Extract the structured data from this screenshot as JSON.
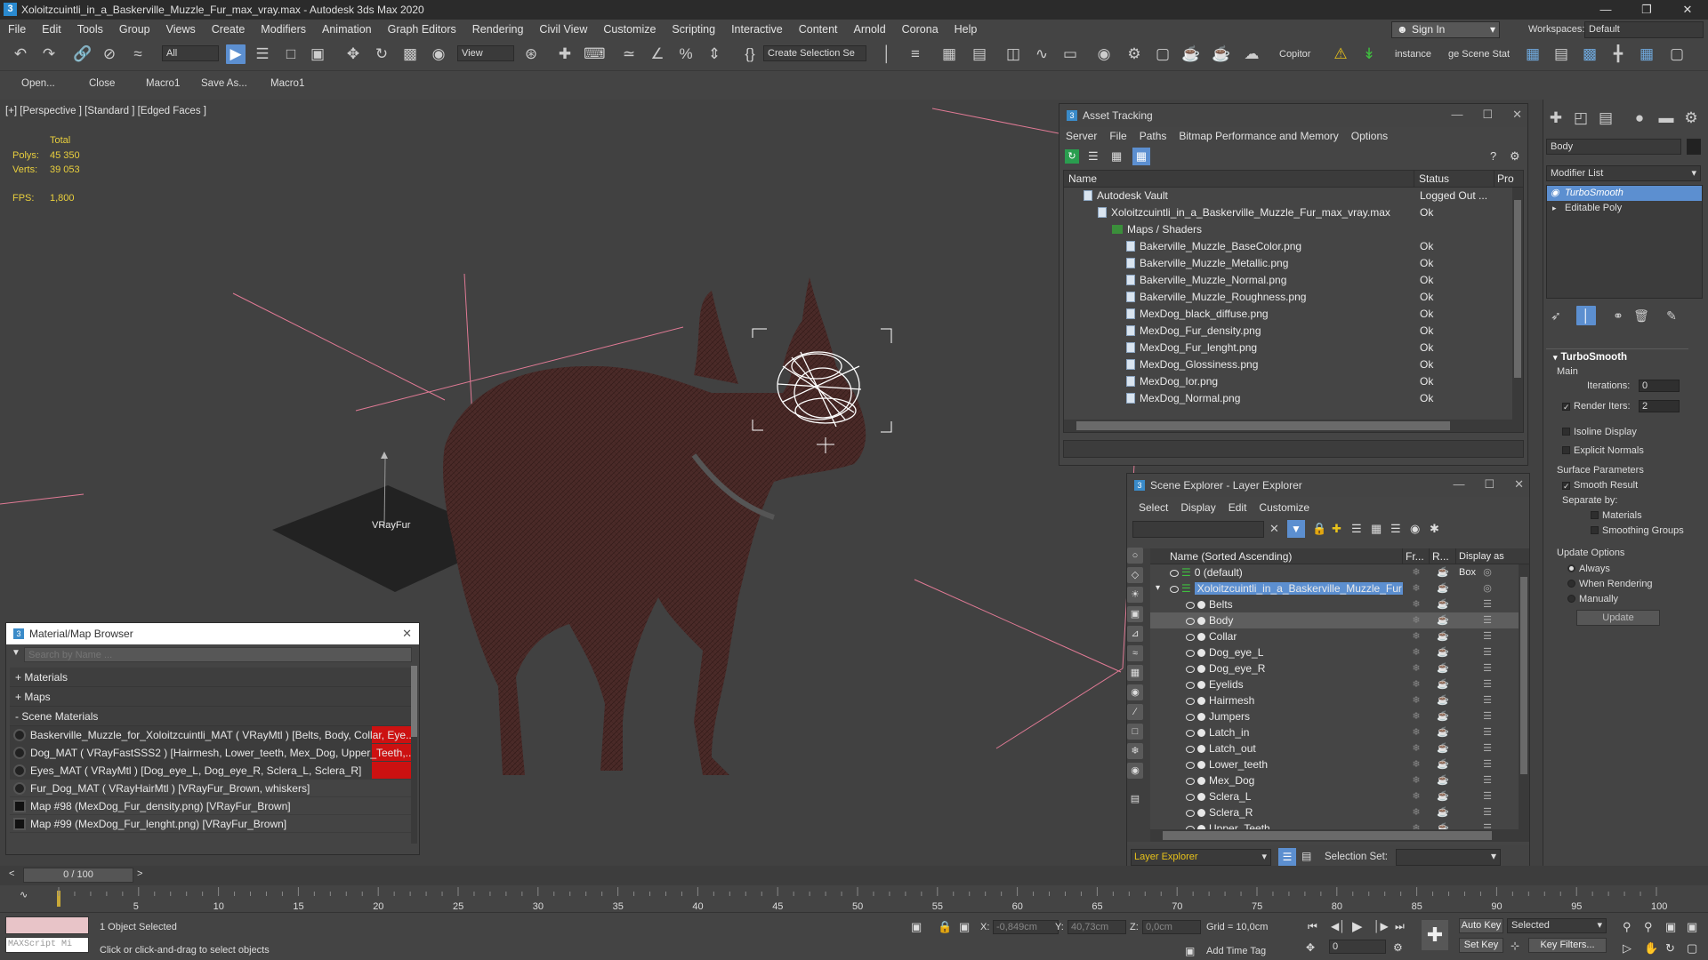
{
  "title": "Xoloitzcuintli_in_a_Baskerville_Muzzle_Fur_max_vray.max - Autodesk 3ds Max 2020",
  "menu": [
    "File",
    "Edit",
    "Tools",
    "Group",
    "Views",
    "Create",
    "Modifiers",
    "Animation",
    "Graph Editors",
    "Rendering",
    "Civil View",
    "Customize",
    "Scripting",
    "Interactive",
    "Content",
    "Arnold",
    "Corona",
    "Help"
  ],
  "signin": "Sign In",
  "workspaces_label": "Workspaces:",
  "workspace": "Default",
  "toolbar": {
    "filter": "All",
    "view": "View",
    "selection_set": "Create Selection Se",
    "copitor": "Copitor",
    "instance": "instance",
    "scene_stat": "ge Scene Stat"
  },
  "macros": [
    "Open...",
    "Close",
    "Macro1",
    "Save As...",
    "Macro1"
  ],
  "viewport": {
    "label": "[+] [Perspective ] [Standard ] [Edged Faces ]",
    "total_label": "Total",
    "polys_label": "Polys:",
    "polys_value": "45 350",
    "verts_label": "Verts:",
    "verts_value": "39 053",
    "fps_label": "FPS:",
    "fps_value": "1,800",
    "vrayfur_label": "VRayFur"
  },
  "asset_tracking": {
    "title": "Asset Tracking",
    "menu": [
      "Server",
      "File",
      "Paths",
      "Bitmap Performance and Memory",
      "Options"
    ],
    "headers": [
      "Name",
      "Status",
      "Pro"
    ],
    "rows": [
      {
        "name": "Autodesk Vault",
        "status": "Logged Out ..."
      },
      {
        "name": "Xoloitzcuintli_in_a_Baskerville_Muzzle_Fur_max_vray.max",
        "status": "Ok"
      },
      {
        "name": "Maps / Shaders",
        "status": ""
      },
      {
        "name": "Bakerville_Muzzle_BaseColor.png",
        "status": "Ok"
      },
      {
        "name": "Bakerville_Muzzle_Metallic.png",
        "status": "Ok"
      },
      {
        "name": "Bakerville_Muzzle_Normal.png",
        "status": "Ok"
      },
      {
        "name": "Bakerville_Muzzle_Roughness.png",
        "status": "Ok"
      },
      {
        "name": "MexDog_black_diffuse.png",
        "status": "Ok"
      },
      {
        "name": "MexDog_Fur_density.png",
        "status": "Ok"
      },
      {
        "name": "MexDog_Fur_lenght.png",
        "status": "Ok"
      },
      {
        "name": "MexDog_Glossiness.png",
        "status": "Ok"
      },
      {
        "name": "MexDog_Ior.png",
        "status": "Ok"
      },
      {
        "name": "MexDog_Normal.png",
        "status": "Ok"
      }
    ]
  },
  "scene_explorer": {
    "title": "Scene Explorer - Layer Explorer",
    "menu": [
      "Select",
      "Display",
      "Edit",
      "Customize"
    ],
    "headers": [
      "Name (Sorted Ascending)",
      "Fr...",
      "R...",
      "Display as Box"
    ],
    "layers": [
      "0 (default)",
      "Xoloitzcuintli_in_a_Baskerville_Muzzle_Fur"
    ],
    "objects": [
      "Belts",
      "Body",
      "Collar",
      "Dog_eye_L",
      "Dog_eye_R",
      "Eyelids",
      "Hairmesh",
      "Jumpers",
      "Latch_in",
      "Latch_out",
      "Lower_teeth",
      "Mex_Dog",
      "Sclera_L",
      "Sclera_R",
      "Upper_Teeth"
    ],
    "footer_explorer": "Layer Explorer",
    "selection_set_label": "Selection Set:"
  },
  "material_browser": {
    "title": "Material/Map Browser",
    "search_placeholder": "Search by Name ...",
    "categories": [
      "+ Materials",
      "+ Maps",
      "- Scene Materials"
    ],
    "items": [
      "Baskerville_Muzzle_for_Xoloitzcuintli_MAT ( VRayMtl ) [Belts, Body, Collar, Eye...",
      "Dog_MAT ( VRayFastSSS2 ) [Hairmesh, Lower_teeth, Mex_Dog, Upper_Teeth,...",
      "Eyes_MAT ( VRayMtl ) [Dog_eye_L, Dog_eye_R, Sclera_L, Sclera_R]",
      "Fur_Dog_MAT ( VRayHairMtl ) [VRayFur_Brown, whiskers]",
      "Map #98 (MexDog_Fur_density.png) [VRayFur_Brown]",
      "Map #99 (MexDog_Fur_lenght.png) [VRayFur_Brown]"
    ]
  },
  "command_panel": {
    "object_name": "Body",
    "modifier_list": "Modifier List",
    "stack": [
      "TurboSmooth",
      "Editable Poly"
    ],
    "rollout_title": "TurboSmooth",
    "main_label": "Main",
    "iterations_label": "Iterations:",
    "iterations_value": "0",
    "render_iters_label": "Render Iters:",
    "render_iters_value": "2",
    "isoline": "Isoline Display",
    "explicit_normals": "Explicit Normals",
    "surface_params": "Surface Parameters",
    "smooth_result": "Smooth Result",
    "separate_by": "Separate by:",
    "materials": "Materials",
    "smoothing_groups": "Smoothing Groups",
    "update_options": "Update Options",
    "always": "Always",
    "when_rendering": "When Rendering",
    "manually": "Manually",
    "update_button": "Update"
  },
  "timeline": {
    "frame": "0 / 100",
    "ticks": [
      "5",
      "10",
      "15",
      "20",
      "25",
      "30",
      "35",
      "40",
      "45",
      "50",
      "55",
      "60",
      "65",
      "70",
      "75",
      "80",
      "85",
      "90",
      "95",
      "100"
    ]
  },
  "status": {
    "maxscript": "MAXScript Mi",
    "selected": "1 Object Selected",
    "hint": "Click or click-and-drag to select objects",
    "x_label": "X:",
    "x_value": "-0,849cm",
    "y_label": "Y:",
    "y_value": "40,73cm",
    "z_label": "Z:",
    "z_value": "0,0cm",
    "grid": "Grid = 10,0cm",
    "add_time_tag": "Add Time Tag",
    "auto_key": "Auto Key",
    "selected_mode": "Selected",
    "set_key": "Set Key",
    "key_filters": "Key Filters...",
    "frame_field": "0"
  }
}
